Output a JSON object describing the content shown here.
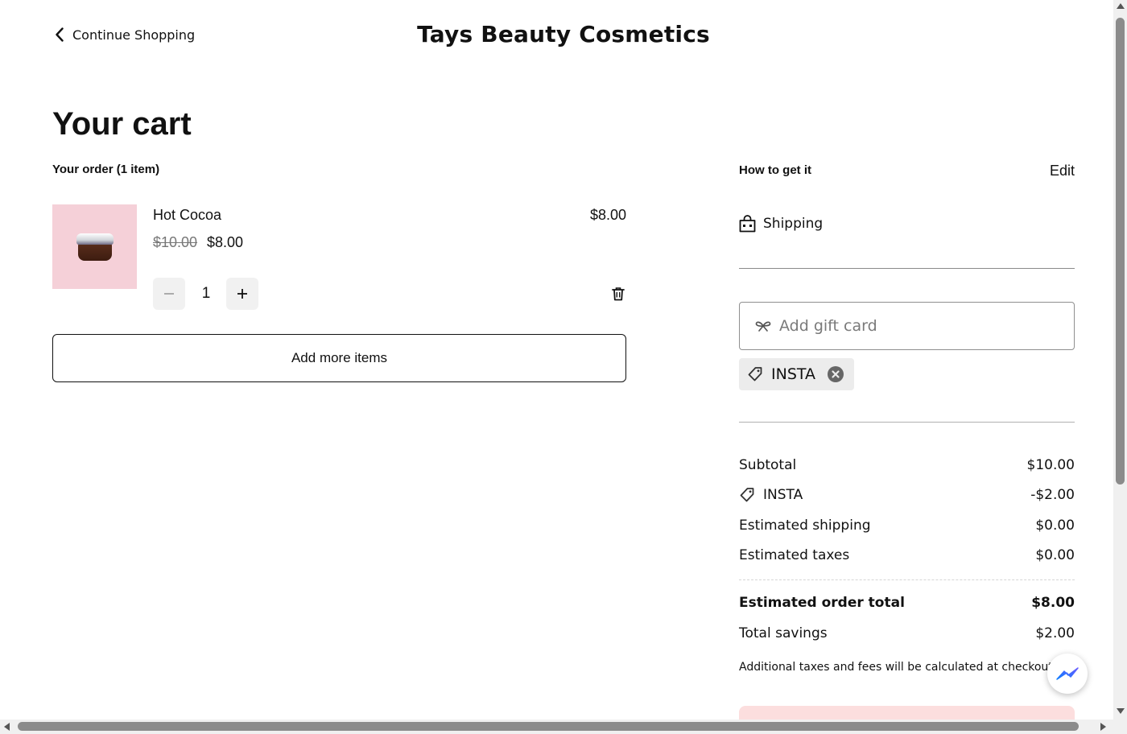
{
  "header": {
    "back_label": "Continue Shopping",
    "store_name": "Tays Beauty Cosmetics"
  },
  "cart": {
    "title": "Your cart",
    "order_heading": "Your order (1 item)",
    "items": [
      {
        "name": "Hot Cocoa",
        "line_total": "$8.00",
        "original_price": "$10.00",
        "sale_price": "$8.00",
        "quantity": "1"
      }
    ],
    "add_more_label": "Add more items"
  },
  "fulfillment": {
    "heading": "How to get it",
    "edit_label": "Edit",
    "method": "Shipping"
  },
  "gift_card": {
    "placeholder": "Add gift card",
    "value": ""
  },
  "promo": {
    "code": "INSTA"
  },
  "summary": {
    "subtotal_label": "Subtotal",
    "subtotal_value": "$10.00",
    "discount_label": "INSTA",
    "discount_value": "-$2.00",
    "shipping_label": "Estimated shipping",
    "shipping_value": "$0.00",
    "taxes_label": "Estimated taxes",
    "taxes_value": "$0.00",
    "total_label": "Estimated order total",
    "total_value": "$8.00",
    "savings_label": "Total savings",
    "savings_value": "$2.00",
    "note": "Additional taxes and fees will be calculated at checkout."
  },
  "icons": {
    "back": "chevron-left-icon",
    "bag": "shopping-bag-icon",
    "gift": "gift-ribbon-icon",
    "tag": "tag-icon",
    "remove": "close-circle-icon",
    "trash": "trash-icon",
    "messenger": "messenger-icon"
  },
  "colors": {
    "thumbnail_bg": "#f5d0d8",
    "checkout_button_bg": "#fcdede",
    "chip_bg": "#ececec",
    "messenger_blue": "#1877f2"
  }
}
